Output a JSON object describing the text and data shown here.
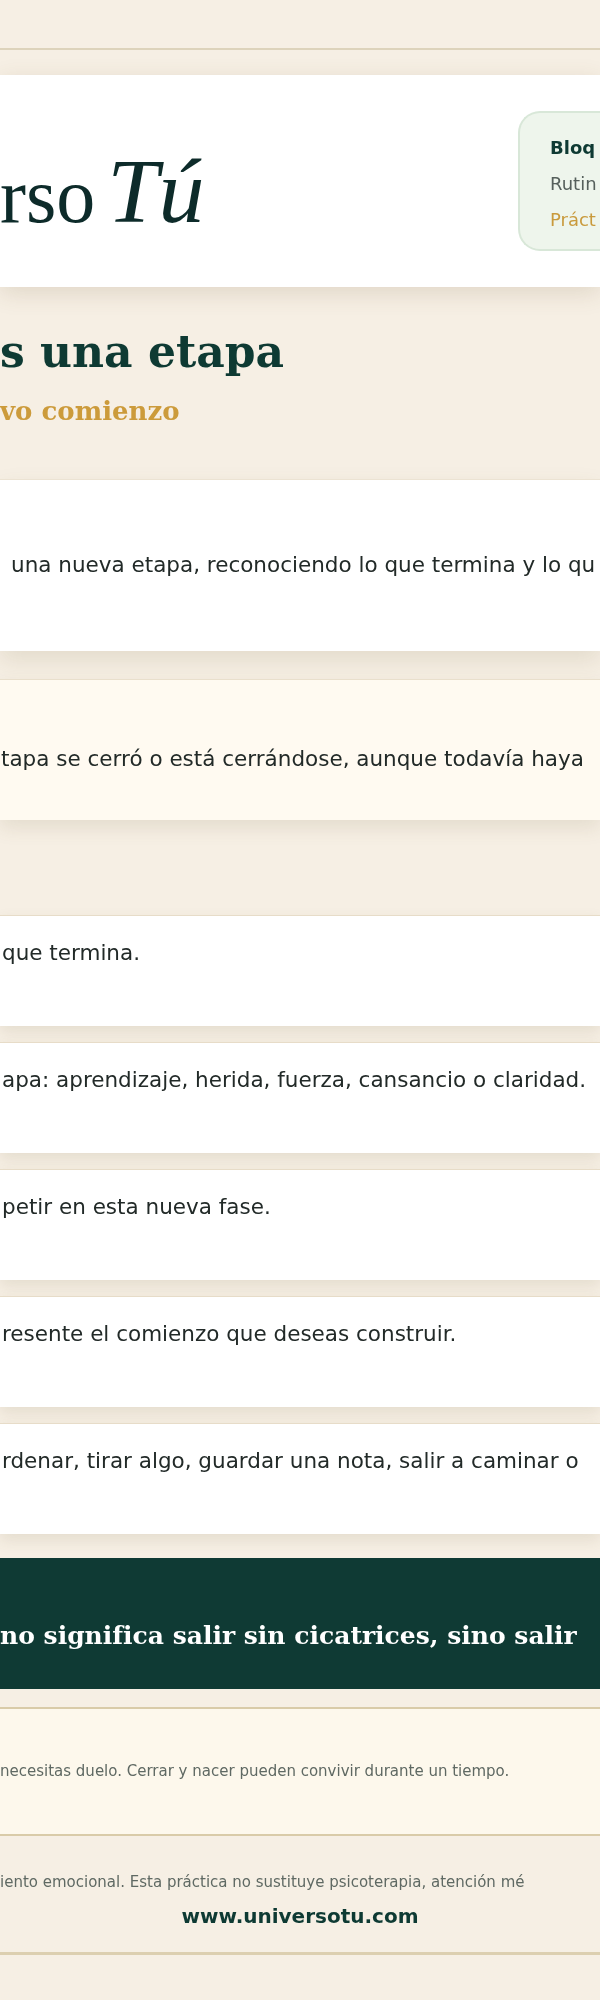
{
  "header": {
    "logo": {
      "wordmark": "rso",
      "script": "Tú"
    },
    "tag_panel": {
      "title": "Bloq",
      "line_1": "Rutin",
      "line_2": "Práct"
    }
  },
  "hero": {
    "title": "s una etapa",
    "subtitle": "vo comienzo"
  },
  "intro_card": {
    "text": "una nueva etapa, reconociendo lo que termina y lo qu"
  },
  "highlight_card": {
    "text": "tapa se cerró o está cerrándose, aunque todavía haya"
  },
  "steps": [
    {
      "text": "que termina."
    },
    {
      "text": "apa: aprendizaje, herida, fuerza, cansancio o claridad."
    },
    {
      "text": "petir en esta nueva fase."
    },
    {
      "text": "resente el comienzo que deseas construir."
    },
    {
      "text": "rdenar, tirar algo, guardar una nota, salir a caminar o"
    }
  ],
  "quote_banner": {
    "text": "no significa salir sin cicatrices, sino salir"
  },
  "note": {
    "text": "necesitas duelo. Cerrar y nacer pueden convivir durante un tiempo."
  },
  "footer": {
    "disclaimer": "iento emocional. Esta práctica no sustituye psicoterapia, atención mé",
    "website": "www.universotu.com"
  }
}
